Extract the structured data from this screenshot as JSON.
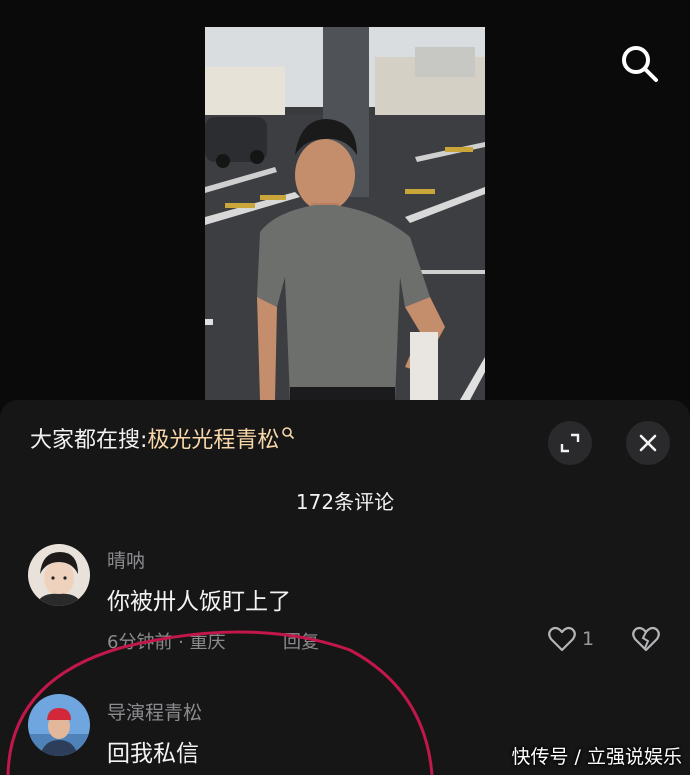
{
  "video": {
    "search_icon": "search-icon"
  },
  "comments_panel": {
    "hot_search_prefix": "大家都在搜:",
    "hot_search_term": "极光光程青松",
    "expand_icon": "expand-icon",
    "close_icon": "close-icon",
    "comment_count": "172条评论",
    "colors": {
      "accent": "#f7d7a8",
      "annotation": "#c2174a"
    }
  },
  "comments": [
    {
      "username": "晴呐",
      "text": "你被卅人饭盯上了",
      "meta": "6分钟前 · 重庆",
      "reply_label": "回复",
      "likes": "1"
    },
    {
      "username": "导演程青松",
      "text": "回我私信"
    }
  ],
  "watermark": "快传号 / 立强说娱乐"
}
